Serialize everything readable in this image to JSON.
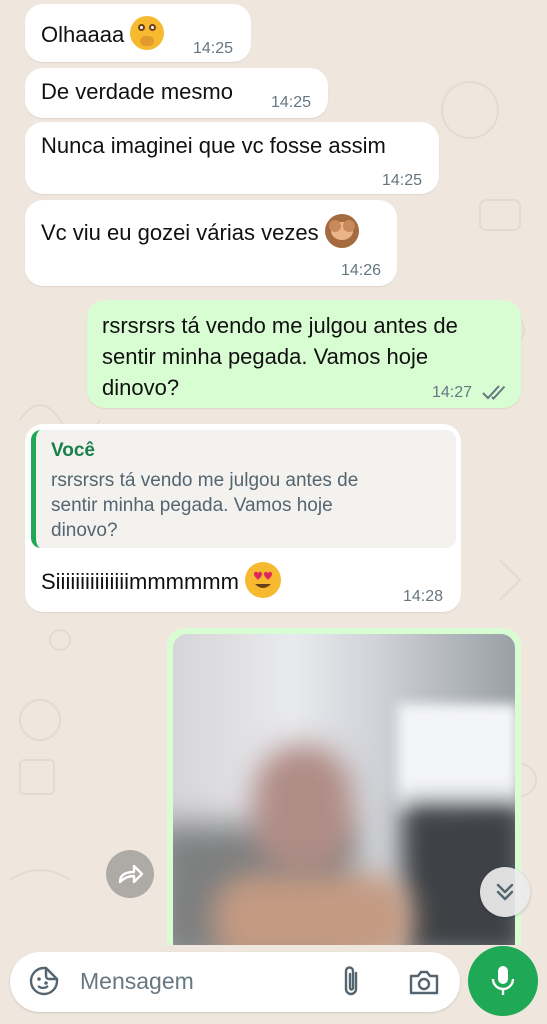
{
  "messages": [
    {
      "text": "Olhaaaa",
      "emoji": "flushed-face-hands",
      "time": "14:25",
      "direction": "incoming"
    },
    {
      "text": "De verdade mesmo",
      "time": "14:25",
      "direction": "incoming"
    },
    {
      "text": "Nunca imaginei que vc fosse assim",
      "time": "14:25",
      "direction": "incoming"
    },
    {
      "text": "Vc viu eu gozei várias vezes",
      "emoji": "see-no-evil-monkey",
      "time": "14:26",
      "direction": "incoming"
    },
    {
      "text_lines": [
        "rsrsrsrs tá vendo me julgou antes de",
        "sentir minha pegada. Vamos hoje",
        "dinovo?"
      ],
      "time": "14:27",
      "status": "read",
      "direction": "outgoing"
    },
    {
      "quote": {
        "author": "Você",
        "lines": [
          "rsrsrsrs tá vendo me julgou antes de",
          "sentir minha pegada. Vamos hoje",
          "dinovo?"
        ]
      },
      "text": "Siiiiiiiiiiiiiiimmmmmm",
      "emoji": "heart-eyes-face",
      "time": "14:28",
      "direction": "incoming"
    },
    {
      "type": "image",
      "blurred": true,
      "direction": "outgoing"
    }
  ],
  "composer": {
    "placeholder": "Mensagem"
  },
  "colors": {
    "incoming": "#ffffff",
    "outgoing": "#d9fdd3",
    "accent": "#1fa855",
    "background": "#efe7dd"
  }
}
